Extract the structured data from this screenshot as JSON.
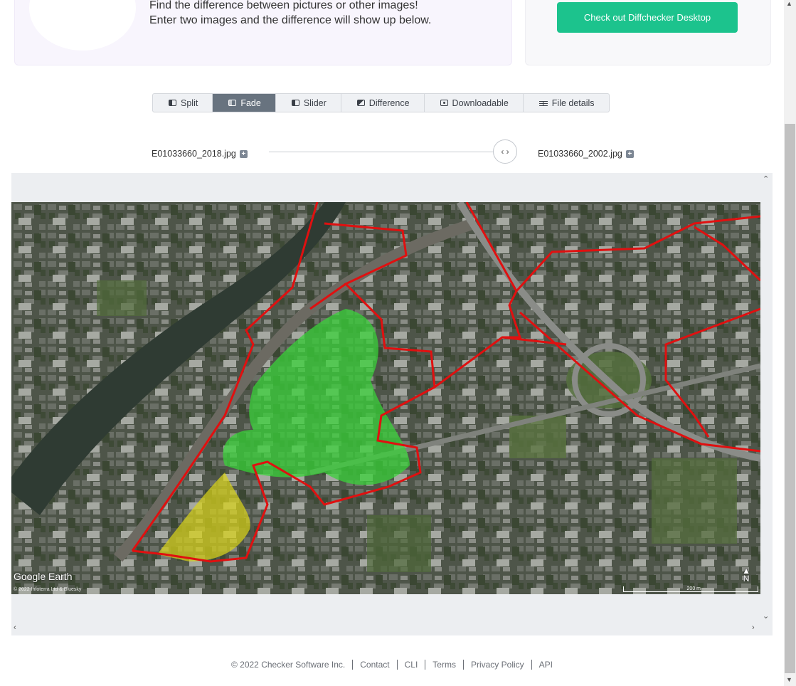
{
  "hero": {
    "line1": "Find the difference between pictures or other images!",
    "line2": "Enter two images and the difference will show up below."
  },
  "promo": {
    "button_label": "Check out Diffchecker Desktop"
  },
  "tabs": [
    {
      "label": "Split",
      "icon": "split-view-icon"
    },
    {
      "label": "Fade",
      "icon": "fade-icon",
      "active": true
    },
    {
      "label": "Slider",
      "icon": "slider-icon"
    },
    {
      "label": "Difference",
      "icon": "difference-icon"
    },
    {
      "label": "Downloadable",
      "icon": "download-icon"
    },
    {
      "label": "File details",
      "icon": "file-details-icon"
    }
  ],
  "files": {
    "left": "E01033660_2018.jpg",
    "right": "E01033660_2002.jpg"
  },
  "fade": {
    "value": 1.0
  },
  "image_overlay": {
    "logo": "Google Earth",
    "copyright": "© 2022 Infoterra Ltd & Bluesky",
    "scale": "200 m",
    "north": "N"
  },
  "footer": {
    "copyright": "© 2022 Checker Software Inc.",
    "links": [
      "Contact",
      "CLI",
      "Terms",
      "Privacy Policy",
      "API"
    ]
  },
  "colors": {
    "accent": "#1cc38d",
    "active_tab": "#68737f",
    "boundary": "#e01010",
    "added": "#3ad13a",
    "removed": "#d8d21a"
  }
}
